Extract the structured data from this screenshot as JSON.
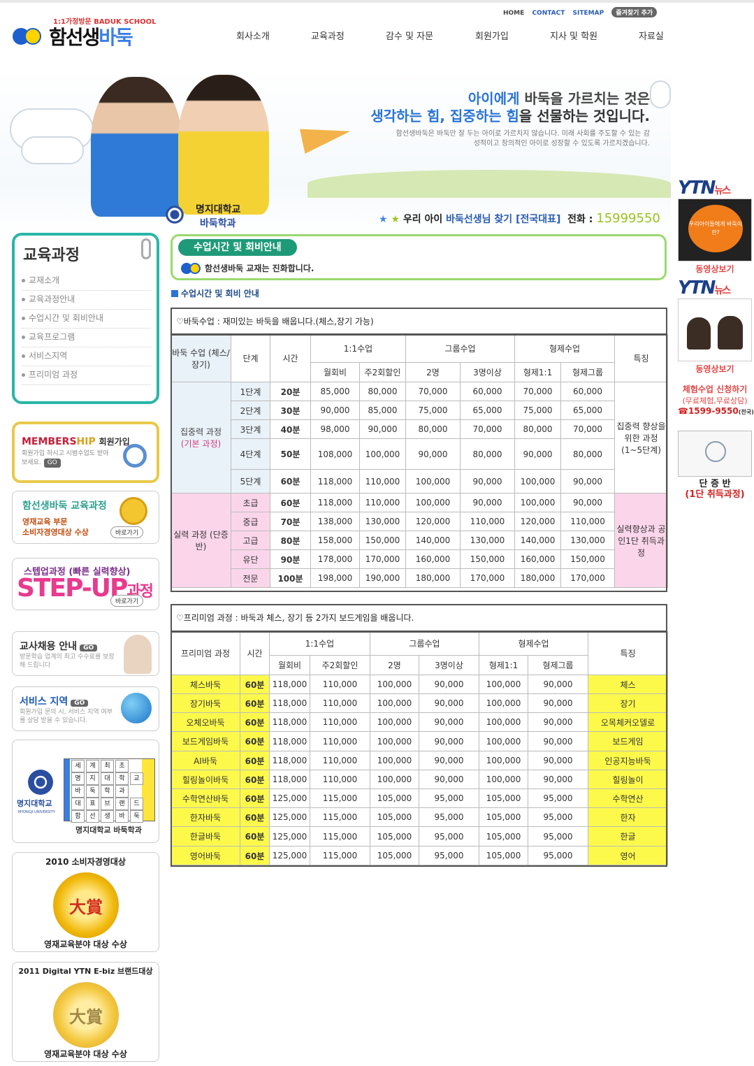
{
  "header": {
    "logo_tagline": "1:1가정방문 BADUK SCHOOL",
    "logo_name_black": "함선생",
    "logo_name_blue": "바둑",
    "util_links": [
      "HOME",
      "CONTACT",
      "SITEMAP"
    ],
    "favorite": "즐겨찾기 추가",
    "nav": [
      "회사소개",
      "교육과정",
      "감수 및 자문",
      "회원가입",
      "지사 및 학원",
      "자료실"
    ]
  },
  "hero": {
    "line1_blue": "아이에게",
    "line1_rest": " 바둑을 가르치는 것은",
    "line2_blue": "생각하는 힘, 집중하는 힘",
    "line2_rest": "을 선물하는 것입니다.",
    "sub": "함선생바둑은 바둑만 잘 두는 아이로 가르치지 않습니다. 미래 사회를 주도할 수 있는 감성적이고 창의적인 아이로 성장할 수 있도록 가르치겠습니다.",
    "myongji_1": "명지대학교",
    "myongji_2": "바둑학과",
    "find_1": "우리 아이",
    "find_2": "바둑선생님 찾기 [전국대표]",
    "phone_label": "전화 :",
    "phone": "15999550"
  },
  "left": {
    "lnb_title": "교육과정",
    "lnb_items": [
      "교재소개",
      "교육과정안내",
      "수업시간 및 회비안내",
      "교육프로그램",
      "서비스지역",
      "프리미엄 과정"
    ],
    "member_title_a": "MEMBERS",
    "member_title_b": "HIP",
    "member_title_c": "회원가입",
    "member_desc": "회원가입 하시고 시범수업도 받아 보세요.",
    "go": "GO",
    "edu_title": "함선생바둑 교육과정",
    "edu_desc1": "영재교육 부문",
    "edu_desc2": "소비자경영대상 수상",
    "shortcut": "바로가기",
    "step_title": "스텝업과정 (빠른 실력향상)",
    "step_big": "STEP-UP",
    "step_big2": "과정",
    "teacher_title": "교사채용 안내",
    "teacher_desc": "방문학습 업계의 최고 수수료를 보장해 드립니다",
    "region_title": "서비스 지역",
    "region_desc": "회원가입 문의 시, 서비스 지역 여부를 상담 받을 수 있습니다.",
    "mj_label": "명지대학교",
    "mj_sub": "MYONGJI UNIVERSITY",
    "mj_cap": "명지대학교 바둑학과",
    "mj_grid": [
      "세",
      "계",
      "최",
      "초",
      "명",
      "지",
      "대",
      "학",
      "교",
      "바",
      "둑",
      "학",
      "과",
      "대",
      "표",
      "브",
      "랜",
      "드",
      "함",
      "선",
      "생",
      "바",
      "둑"
    ],
    "award1_title": "2010 소비자경영대상",
    "award1_cap": "영재교육분야 대상 수상",
    "award2_title": "2011 Digital YTN E-biz 브랜드대상",
    "award2_cap": "영재교육분야 대상 수상",
    "award_char": "大賞"
  },
  "right": {
    "ytn": "YTN",
    "ytn_news": "뉴스",
    "ytn1_thumb": "우리아이들에게 바둑이란?",
    "video": "동영상보기",
    "trial_title": "체험수업 신청하기",
    "trial_sub": "(무료체험,무료상담)",
    "trial_phone": "☎1599-9550",
    "trial_phone_note": "(전국)",
    "dan_1": "단 증 반",
    "dan_2": "(1단 취득과정)"
  },
  "main": {
    "section_pill": "수업시간 및 회비안내",
    "section_msg": "함선생바둑 교재는 진화합니다.",
    "sub_title": "수업시간 및 회비 안내",
    "cap1": "♡바둑수업 : 재미있는 바둑을 배웁니다.(체스,장기 가능)",
    "cap2": "♡프리미엄 과정 : 바둑과 체스, 장기 등 2가지 보드게임을 배웁니다.",
    "t1_head": {
      "col1": "바둑 수업 (체스/장기)",
      "level": "단계",
      "time": "시간",
      "one": "1:1수업",
      "group": "그룹수업",
      "sibling": "형제수업",
      "feature": "특징",
      "monthly": "월회비",
      "twice": "주2회할인",
      "two": "2명",
      "three": "3명이상",
      "sib1": "형제1:1",
      "sibg": "형제그룹"
    },
    "t1_group1": "집중력 과정",
    "t1_group1_sub": "(기본 과정)",
    "t1_group1_feat": "집중력 향상을 위한 과정 (1~5단계)",
    "t1_group2": "실력 과정 (단증반)",
    "t1_group2_feat": "실력향상과 공인1단 취득과정",
    "t1_rows": [
      [
        "1단계",
        "20분",
        "85,000",
        "80,000",
        "70,000",
        "60,000",
        "70,000",
        "60,000"
      ],
      [
        "2단계",
        "30분",
        "90,000",
        "85,000",
        "75,000",
        "65,000",
        "75,000",
        "65,000"
      ],
      [
        "3단계",
        "40분",
        "98,000",
        "90,000",
        "80,000",
        "70,000",
        "80,000",
        "70,000"
      ],
      [
        "4단계",
        "50분",
        "108,000",
        "100,000",
        "90,000",
        "80,000",
        "90,000",
        "80,000"
      ],
      [
        "5단계",
        "60분",
        "118,000",
        "110,000",
        "100,000",
        "90,000",
        "100,000",
        "90,000"
      ],
      [
        "초급",
        "60분",
        "118,000",
        "110,000",
        "100,000",
        "90,000",
        "100,000",
        "90,000"
      ],
      [
        "중급",
        "70분",
        "138,000",
        "130,000",
        "120,000",
        "110,000",
        "120,000",
        "110,000"
      ],
      [
        "고급",
        "80분",
        "158,000",
        "150,000",
        "140,000",
        "130,000",
        "140,000",
        "130,000"
      ],
      [
        "유단",
        "90분",
        "178,000",
        "170,000",
        "160,000",
        "150,000",
        "160,000",
        "150,000"
      ],
      [
        "전문",
        "100분",
        "198,000",
        "190,000",
        "180,000",
        "170,000",
        "180,000",
        "170,000"
      ]
    ],
    "t2_head": {
      "col1": "프리미엄 과정",
      "time": "시간",
      "one": "1:1수업",
      "group": "그룹수업",
      "sibling": "형제수업",
      "feature": "특징",
      "monthly": "월회비",
      "twice": "주2회할인",
      "two": "2명",
      "three": "3명이상",
      "sib1": "형제1:1",
      "sibg": "형제그룹"
    },
    "t2_rows": [
      [
        "체스바둑",
        "60분",
        "118,000",
        "110,000",
        "100,000",
        "90,000",
        "100,000",
        "90,000",
        "체스"
      ],
      [
        "장기바둑",
        "60분",
        "118,000",
        "110,000",
        "100,000",
        "90,000",
        "100,000",
        "90,000",
        "장기"
      ],
      [
        "오체오바둑",
        "60분",
        "118,000",
        "110,000",
        "100,000",
        "90,000",
        "100,000",
        "90,000",
        "오목체커오델로"
      ],
      [
        "보드게임바둑",
        "60분",
        "118,000",
        "110,000",
        "100,000",
        "90,000",
        "100,000",
        "90,000",
        "보드게임"
      ],
      [
        "AI바둑",
        "60분",
        "118,000",
        "110,000",
        "100,000",
        "90,000",
        "100,000",
        "90,000",
        "인공지능바둑"
      ],
      [
        "힐링놀이바둑",
        "60분",
        "118,000",
        "110,000",
        "100,000",
        "90,000",
        "100,000",
        "90,000",
        "힐링놀이"
      ],
      [
        "수학연산바둑",
        "60분",
        "125,000",
        "115,000",
        "105,000",
        "95,000",
        "105,000",
        "95,000",
        "수학연산"
      ],
      [
        "한자바둑",
        "60분",
        "125,000",
        "115,000",
        "105,000",
        "95,000",
        "105,000",
        "95,000",
        "한자"
      ],
      [
        "한글바둑",
        "60분",
        "125,000",
        "115,000",
        "105,000",
        "95,000",
        "105,000",
        "95,000",
        "한글"
      ],
      [
        "영어바둑",
        "60분",
        "125,000",
        "115,000",
        "105,000",
        "95,000",
        "105,000",
        "95,000",
        "영어"
      ]
    ]
  }
}
